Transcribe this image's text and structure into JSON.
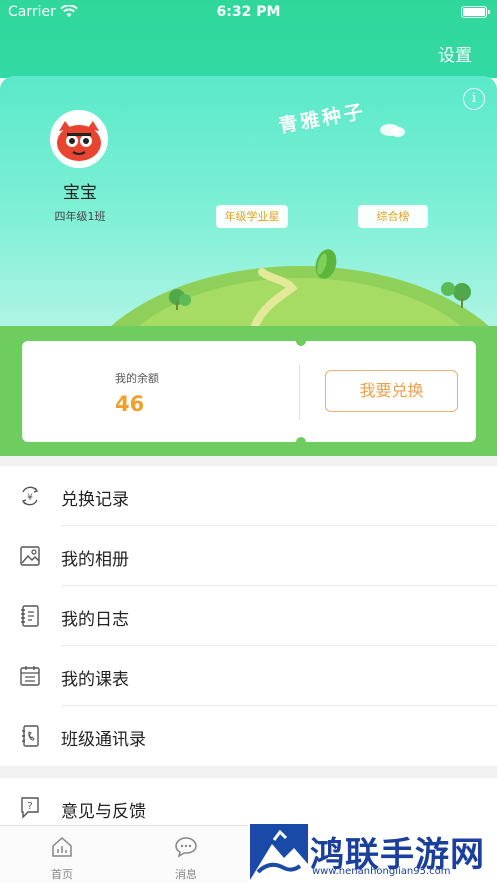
{
  "status_bar": {
    "carrier": "Carrier",
    "time": "6:32 PM"
  },
  "header": {
    "settings_label": "设置"
  },
  "profile": {
    "name": "宝宝",
    "class_name": "四年级1班",
    "brand_text": "青雅种子",
    "tags": [
      "年级学业星",
      "综合榜"
    ]
  },
  "balance": {
    "label": "我的余额",
    "value": "46",
    "exchange_label": "我要兑换"
  },
  "menu": {
    "items": [
      {
        "label": "兑换记录",
        "icon": "exchange-record-icon"
      },
      {
        "label": "我的相册",
        "icon": "album-icon"
      },
      {
        "label": "我的日志",
        "icon": "journal-icon"
      },
      {
        "label": "我的课表",
        "icon": "calendar-icon"
      },
      {
        "label": "班级通讯录",
        "icon": "address-book-icon"
      }
    ],
    "feedback": {
      "label": "意见与反馈",
      "icon": "feedback-icon"
    }
  },
  "tabbar": {
    "home_label": "首页",
    "message_label": "消息"
  },
  "watermark": {
    "title": "鸿联手游网",
    "url": "www.henanhonglian95.com"
  },
  "colors": {
    "header_green": "#2fd89a",
    "balance_green": "#6fcc5e",
    "accent_orange": "#f0a030"
  }
}
